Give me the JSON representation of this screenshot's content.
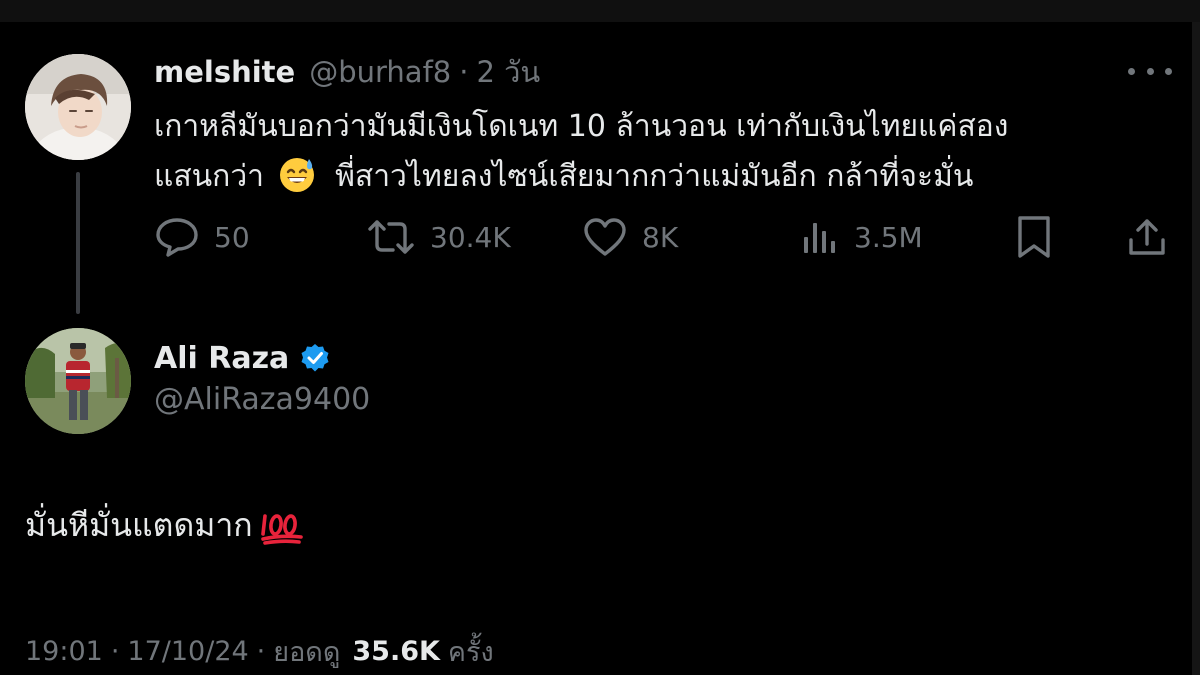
{
  "parent_tweet": {
    "display_name": "melshite",
    "handle": "@burhaf8",
    "separator": "·",
    "time": "2 วัน",
    "text_line1": "เกาหลีมันบอกว่ามันมีเงินโดเนท 10 ล้านวอน เท่ากับเงินไทยแค่สอง",
    "text_line2a": "แสนกว่า",
    "text_line2b": "พี่สาวไทยลงไซน์เสียมากกว่าแม่มันอีก กล้าที่จะมั่น",
    "emoji": "grinning-face-with-sweat",
    "more_icon": "more-horizontal-icon",
    "actions": {
      "replies": {
        "icon": "reply-icon",
        "count": "50"
      },
      "reposts": {
        "icon": "repost-icon",
        "count": "30.4K"
      },
      "likes": {
        "icon": "heart-icon",
        "count": "8K"
      },
      "views": {
        "icon": "analytics-icon",
        "count": "3.5M"
      },
      "bookmark": {
        "icon": "bookmark-icon"
      },
      "share": {
        "icon": "share-icon"
      }
    }
  },
  "reply_tweet": {
    "display_name": "Ali Raza",
    "verified": true,
    "handle": "@AliRaza9400",
    "text": "มั่นหีมั่นแตดมาก",
    "emoji": "hundred-points",
    "meta": {
      "time": "19:01",
      "date": "17/10/24",
      "views_label": "ยอดดู",
      "views_count": "35.6K",
      "views_suffix": "ครั้ง",
      "separator": "·"
    }
  },
  "colors": {
    "background": "#000000",
    "text_primary": "#e7e9ea",
    "text_secondary": "#71767b",
    "verified_blue": "#1d9bf0",
    "emoji_red": "#e8233b"
  }
}
